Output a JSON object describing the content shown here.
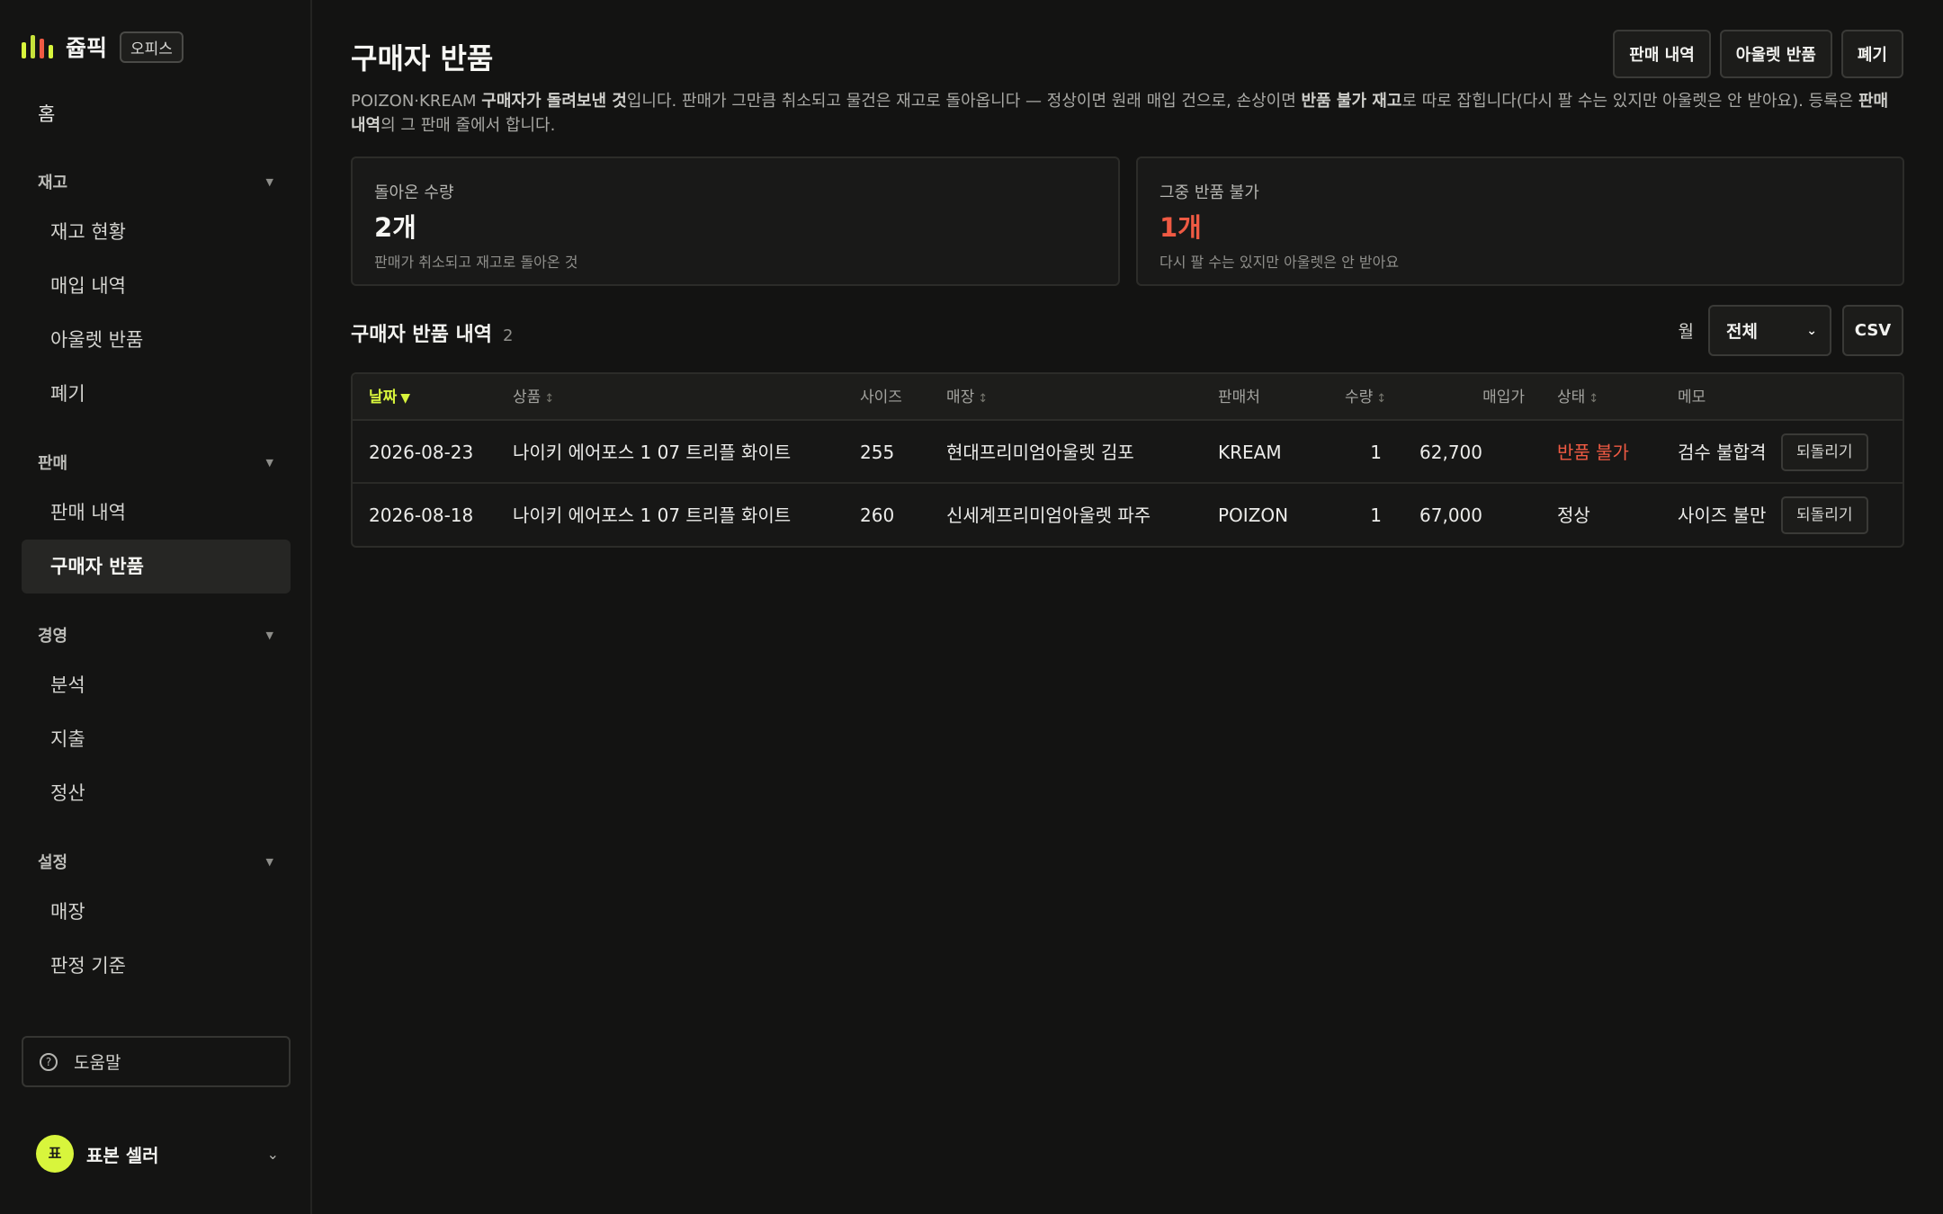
{
  "brand": {
    "name": "쥽픽",
    "tag": "오피스",
    "bar_colors": [
      "#d8f53c",
      "#c7e23a",
      "#ef5a43",
      "#d8f53c"
    ]
  },
  "sidebar": {
    "home": "홈",
    "sections": [
      {
        "title": "재고",
        "items": [
          "재고 현황",
          "매입 내역",
          "아울렛 반품",
          "폐기"
        ]
      },
      {
        "title": "판매",
        "items": [
          "판매 내역",
          "구매자 반품"
        ]
      },
      {
        "title": "경영",
        "items": [
          "분석",
          "지출",
          "정산"
        ]
      },
      {
        "title": "설정",
        "items": [
          "매장",
          "판정 기준"
        ]
      }
    ],
    "active_item": "구매자 반품",
    "help": "도움말",
    "user": {
      "initial": "표",
      "name": "표본 셀러"
    }
  },
  "header": {
    "title": "구매자 반품",
    "actions": [
      "판매 내역",
      "아울렛 반품",
      "폐기"
    ]
  },
  "description": {
    "p1": "POIZON·KREAM ",
    "b1": "구매자가 돌려보낸 것",
    "p2": "입니다. 판매가 그만큼 취소되고 물건은 재고로 돌아옵니다 — 정상이면 원래 매입 건으로, 손상이면 ",
    "b2": "반품 불가 재고",
    "p3": "로 따로 잡힙니다(다시 팔 수는 있지만 아울렛은 안 받아요). 등록은 ",
    "b3": "판매 내역",
    "p4": "의 그 판매 줄에서 합니다."
  },
  "cards": [
    {
      "label": "돌아온 수량",
      "value": "2개",
      "sub": "판매가 취소되고 재고로 돌아온 것"
    },
    {
      "label": "그중 반품 불가",
      "value": "1개",
      "sub": "다시 팔 수는 있지만 아울렛은 안 받아요"
    }
  ],
  "list": {
    "title": "구매자 반품 내역",
    "count": "2",
    "month_label": "월",
    "month_value": "전체",
    "csv": "CSV"
  },
  "table": {
    "columns": {
      "date": "날짜",
      "product": "상품",
      "size": "사이즈",
      "store": "매장",
      "seller": "판매처",
      "qty": "수량",
      "cost": "매입가",
      "status": "상태",
      "memo": "메모"
    },
    "sort_desc": "▼",
    "sort_both": "↕",
    "rows": [
      {
        "date": "2026-08-23",
        "product": "나이키 에어포스 1 07 트리플 화이트",
        "size": "255",
        "store": "현대프리미엄아울렛 김포",
        "seller": "KREAM",
        "qty": "1",
        "cost": "62,700",
        "status": "반품 불가",
        "memo": "검수 불합격",
        "action": "되돌리기"
      },
      {
        "date": "2026-08-18",
        "product": "나이키 에어포스 1 07 트리플 화이트",
        "size": "260",
        "store": "신세계프리미엄아울렛 파주",
        "seller": "POIZON",
        "qty": "1",
        "cost": "67,000",
        "status": "정상",
        "memo": "사이즈 불만",
        "action": "되돌리기"
      }
    ]
  },
  "colors": {
    "accent": "#d8f53c",
    "danger": "#ef5a43",
    "background": "#131312"
  }
}
